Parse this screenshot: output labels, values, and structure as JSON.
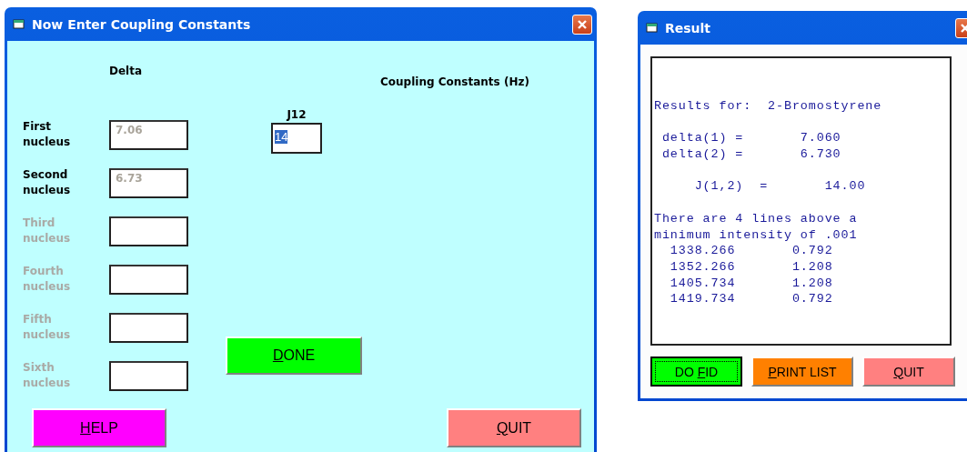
{
  "entry_window": {
    "title": "Now Enter Coupling Constants",
    "delta_header": "Delta",
    "coupling_header": "Coupling Constants (Hz)",
    "nuclei": [
      {
        "label": "First nucleus",
        "value": "7.06",
        "disabled": false
      },
      {
        "label": "Second nucleus",
        "value": "6.73",
        "disabled": false
      },
      {
        "label": "Third nucleus",
        "disabled": true
      },
      {
        "label": "Fourth nucleus",
        "disabled": true
      },
      {
        "label": "Fifth nucleus",
        "disabled": true
      },
      {
        "label": "Sixth nucleus",
        "disabled": true
      }
    ],
    "couplings": [
      {
        "label": "J12",
        "value": "14",
        "selected": true
      }
    ],
    "done_button": {
      "key": "D",
      "post": "ONE",
      "color": "#00ff00"
    },
    "buttons": [
      {
        "key": "H",
        "post": "ELP",
        "color": "#ff00ff"
      },
      {
        "key": "Q",
        "post": "UIT",
        "color": "#ff8080"
      }
    ]
  },
  "result_window": {
    "title": "Result",
    "output": [
      [
        "Results for:  2-Bromostyrene"
      ],
      [
        " delta(1) =       7.060",
        " delta(2) =       6.730"
      ],
      [
        "     J(1,2)  =       14.00"
      ],
      [
        "There are 4 lines above a",
        "minimum intensity of .001",
        "  1338.266       0.792",
        "  1352.266       1.208",
        "  1405.734       1.208",
        "  1419.734       0.792"
      ]
    ],
    "buttons": [
      {
        "pre": "DO ",
        "key": "F",
        "post": "ID",
        "color": "#00ff00",
        "focused": true
      },
      {
        "key": "P",
        "post": "RINT LIST",
        "color": "#ff8000",
        "focused": false
      },
      {
        "key": "Q",
        "post": "UIT",
        "color": "#ff8080",
        "focused": false
      }
    ]
  }
}
